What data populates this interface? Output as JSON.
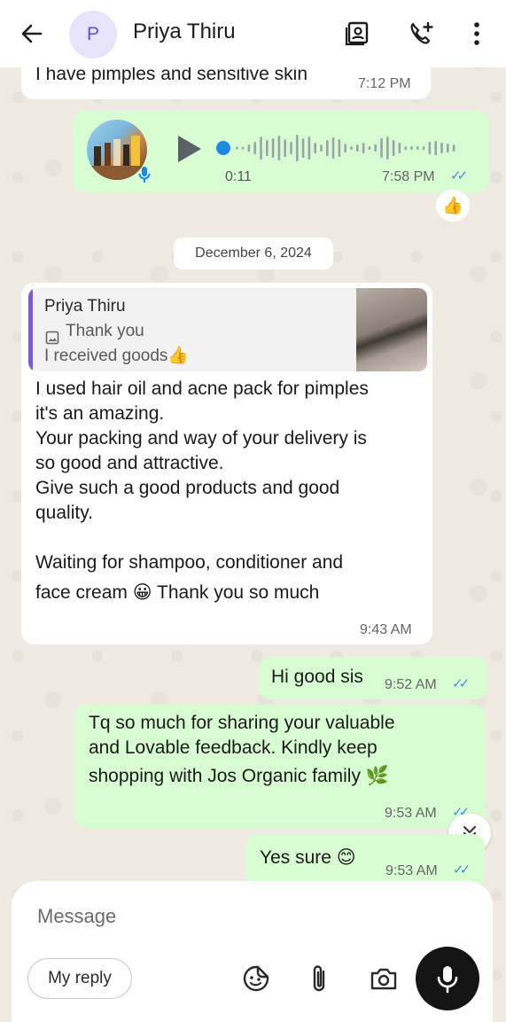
{
  "header": {
    "avatar_initial": "P",
    "contact_name": "Priya Thiru"
  },
  "messages": {
    "m1": {
      "text": "I have pimples and sensitive skin",
      "time": "7:12 PM"
    },
    "voice": {
      "duration": "0:11",
      "time": "7:58 PM"
    },
    "reaction": "👍",
    "date_chip": "December 6, 2024",
    "m2": {
      "quote_author": "Priya Thiru",
      "quote_line1": "Thank you",
      "quote_line2": "I received goods👍",
      "lines": [
        "I used hair oil and  acne pack for pimples",
        "it's an amazing.",
        "Your packing and way of your delivery is",
        "so good and attractive.",
        "Give such a good products and good",
        "quality.",
        "Waiting for shampoo, conditioner and",
        "face cream 😀 Thank you so much"
      ],
      "time": "9:43 AM"
    },
    "m3": {
      "text": "Hi good sis",
      "time": "9:52 AM"
    },
    "m4": {
      "lines": [
        "Tq so much for sharing your valuable",
        "and Lovable feedback. Kindly keep",
        "shopping with Jos Organic family 🌿"
      ],
      "time": "9:53 AM"
    },
    "m5": {
      "text": "Yes sure 😊",
      "time": "9:53 AM"
    }
  },
  "composer": {
    "placeholder": "Message",
    "reply_chip": "My reply"
  },
  "colors": {
    "incoming": "#ffffff",
    "outgoing": "#d9fdd3",
    "tick_blue": "#4a8fd9",
    "quote_bar": "#7b5bd6"
  }
}
